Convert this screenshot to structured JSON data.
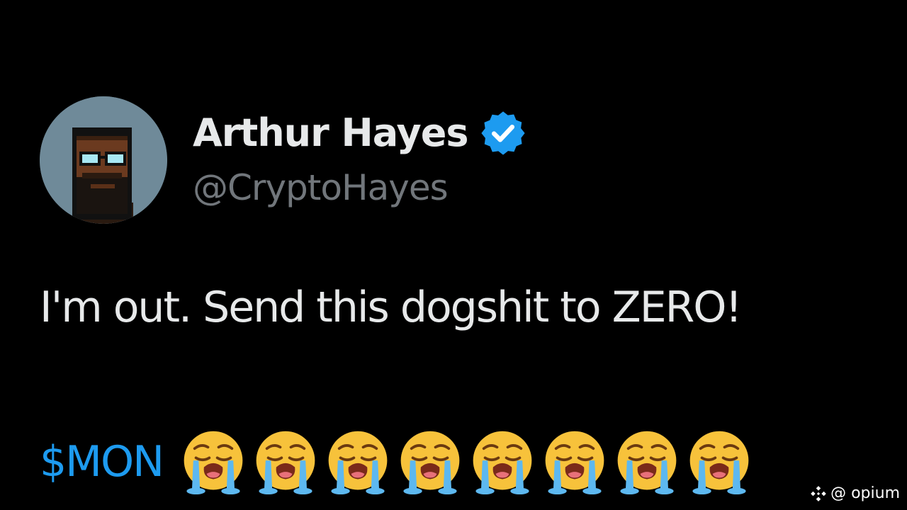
{
  "tweet": {
    "author": {
      "display_name": "Arthur Hayes",
      "handle": "@CryptoHayes",
      "verified": true,
      "avatar_icon": "pixel-art-avatar"
    },
    "text": "I'm out. Send this dogshit to ZERO!",
    "cashtag": "$MON",
    "emoji": {
      "name": "loudly-crying-face",
      "count": 8
    }
  },
  "watermark": {
    "label": "@ opium",
    "icon": "diamond-logo-icon"
  },
  "colors": {
    "background": "#000000",
    "text": "#e7e9ea",
    "handle": "#71767b",
    "link": "#1d9bf0",
    "verified_badge": "#1d9bf0"
  }
}
